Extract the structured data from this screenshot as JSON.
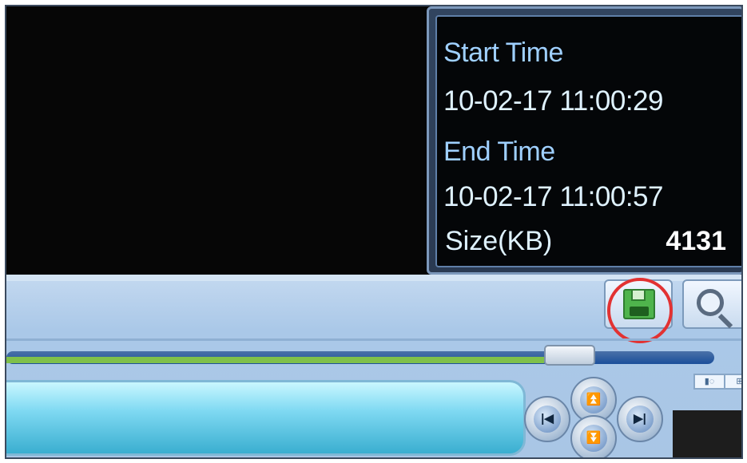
{
  "info": {
    "start_label": "Start Time",
    "start_value": "10-02-17 11:00:29",
    "end_label": "End Time",
    "end_value": "10-02-17 11:00:57",
    "size_label": "Size(KB)",
    "size_value": "4131"
  },
  "toolbar": {
    "save_icon": "save-icon",
    "search_icon": "search-icon"
  },
  "playback": {
    "progress": 0.76
  },
  "colors": {
    "highlight": "#e23232",
    "progress": "#7fc04a",
    "info_text": "#9fd0ff"
  }
}
